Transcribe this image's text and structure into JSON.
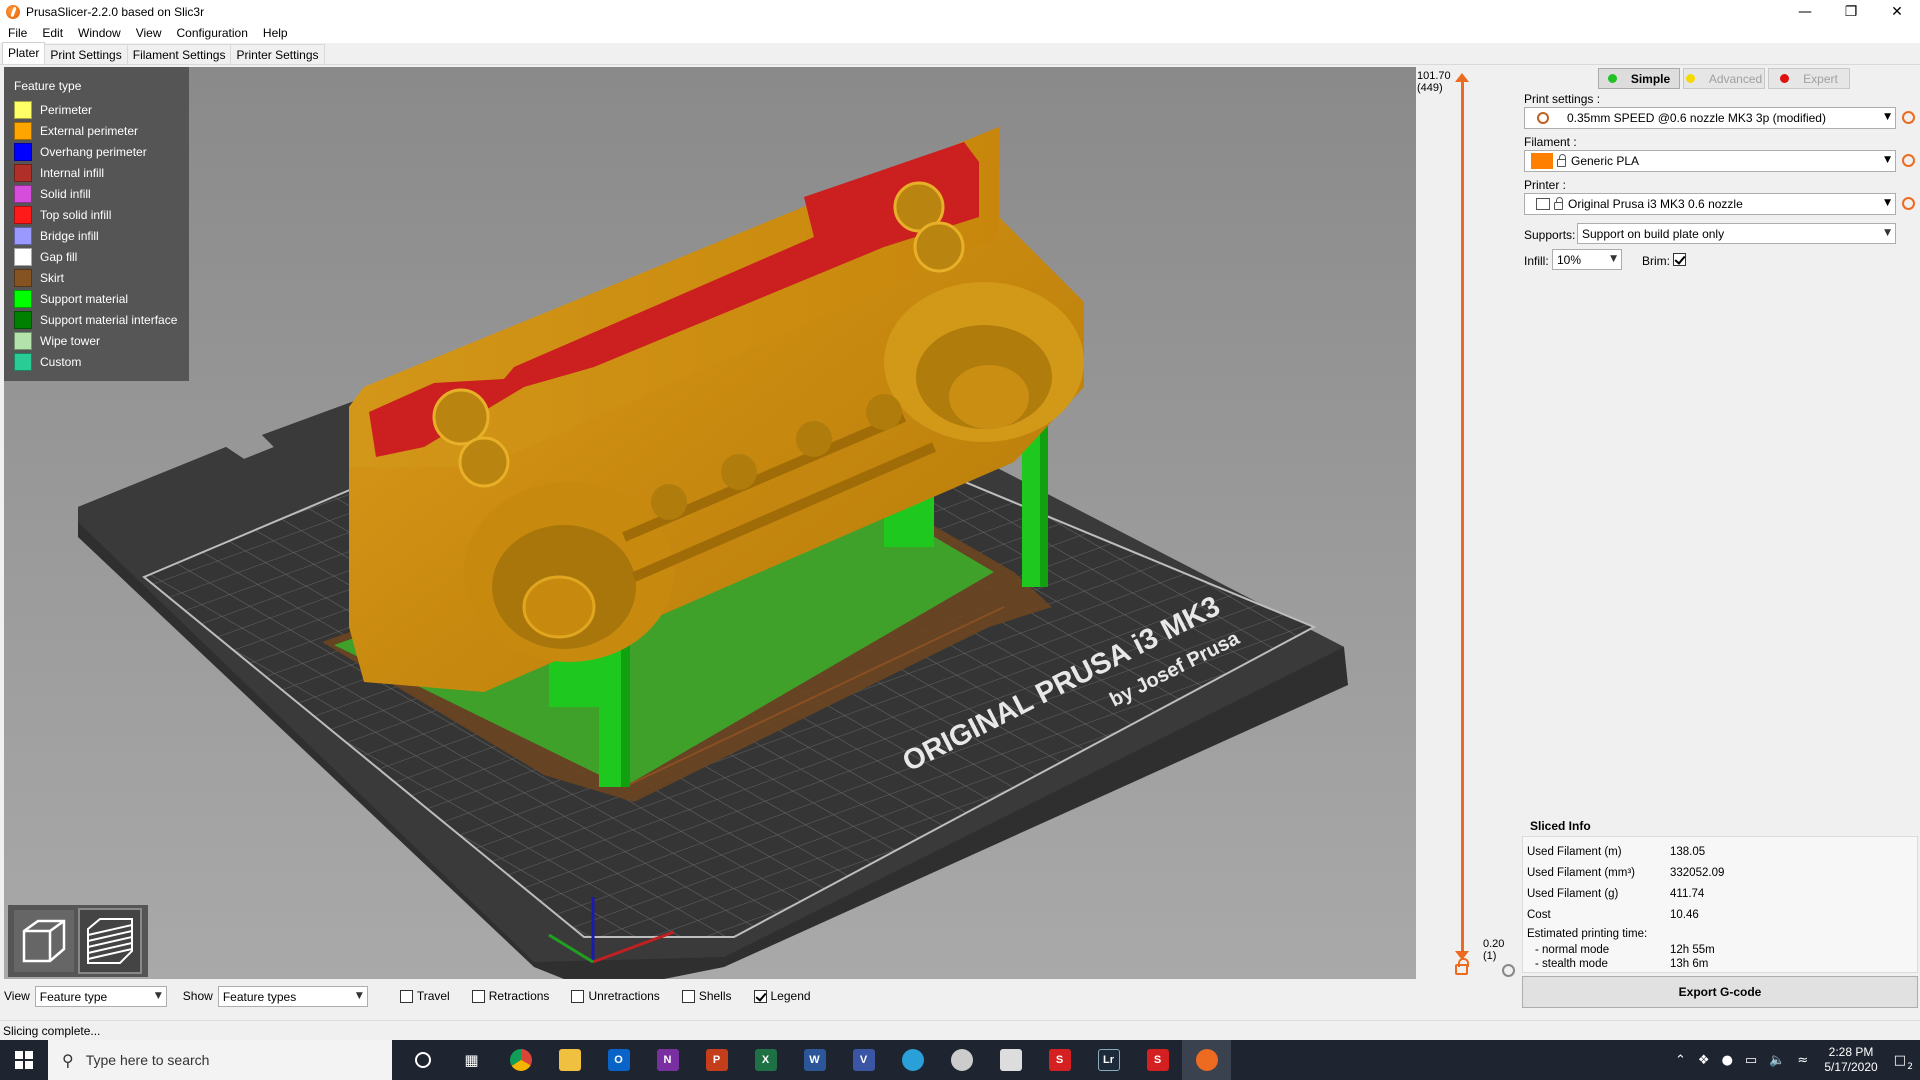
{
  "window": {
    "title": "PrusaSlicer-2.2.0 based on Slic3r"
  },
  "menu": [
    "File",
    "Edit",
    "Window",
    "View",
    "Configuration",
    "Help"
  ],
  "tabs": [
    {
      "label": "Plater",
      "active": true
    },
    {
      "label": "Print Settings",
      "active": false
    },
    {
      "label": "Filament Settings",
      "active": false
    },
    {
      "label": "Printer Settings",
      "active": false
    }
  ],
  "legend": {
    "title": "Feature type",
    "items": [
      {
        "label": "Perimeter",
        "color": "#ffff66"
      },
      {
        "label": "External perimeter",
        "color": "#ffa500"
      },
      {
        "label": "Overhang perimeter",
        "color": "#0000ff"
      },
      {
        "label": "Internal infill",
        "color": "#b03029"
      },
      {
        "label": "Solid infill",
        "color": "#d64ddb"
      },
      {
        "label": "Top solid infill",
        "color": "#ff1a1a"
      },
      {
        "label": "Bridge infill",
        "color": "#9999ff"
      },
      {
        "label": "Gap fill",
        "color": "#ffffff"
      },
      {
        "label": "Skirt",
        "color": "#845321"
      },
      {
        "label": "Support material",
        "color": "#00ff00"
      },
      {
        "label": "Support material interface",
        "color": "#008000"
      },
      {
        "label": "Wipe tower",
        "color": "#b3e3ab"
      },
      {
        "label": "Custom",
        "color": "#28cc94"
      }
    ]
  },
  "bed": {
    "brand": "ORIGINAL PRUSA i3 MK3",
    "by": "by Josef Prusa"
  },
  "layer_slider": {
    "top_value": "101.70",
    "top_layer": "(449)",
    "bottom_value": "0.20",
    "bottom_layer": "(1)"
  },
  "view_toolbar": {
    "view_label": "View",
    "view_value": "Feature type",
    "show_label": "Show",
    "show_value": "Feature types",
    "checkboxes": [
      {
        "label": "Travel",
        "checked": false
      },
      {
        "label": "Retractions",
        "checked": false
      },
      {
        "label": "Unretractions",
        "checked": false
      },
      {
        "label": "Shells",
        "checked": false
      },
      {
        "label": "Legend",
        "checked": true
      }
    ]
  },
  "status": "Slicing complete...",
  "sidebar": {
    "modes": [
      {
        "label": "Simple",
        "color": "#22c022",
        "active": true
      },
      {
        "label": "Advanced",
        "color": "#f5d900",
        "active": false
      },
      {
        "label": "Expert",
        "color": "#e01010",
        "active": false
      }
    ],
    "print_settings_label": "Print settings :",
    "print_settings_value": "0.35mm SPEED @0.6 nozzle MK3 3p (modified)",
    "filament_label": "Filament :",
    "filament_value": "Generic PLA",
    "filament_color": "#ff8000",
    "printer_label": "Printer :",
    "printer_value": "Original Prusa i3 MK3 0.6 nozzle",
    "supports_label": "Supports:",
    "supports_value": "Support on build plate only",
    "infill_label": "Infill:",
    "infill_value": "10%",
    "brim_label": "Brim:",
    "brim_checked": true,
    "sliced_info": {
      "title": "Sliced Info",
      "rows": [
        {
          "k": "Used Filament (m)",
          "v": "138.05"
        },
        {
          "k": "Used Filament (mm³)",
          "v": "332052.09"
        },
        {
          "k": "Used Filament (g)",
          "v": "411.74"
        },
        {
          "k": "Cost",
          "v": "10.46"
        }
      ],
      "time_label": "Estimated printing time:",
      "normal_label": "- normal mode",
      "normal_value": "12h 55m",
      "stealth_label": "- stealth mode",
      "stealth_value": "13h 6m"
    },
    "export_label": "Export G-code"
  },
  "taskbar": {
    "search_placeholder": "Type here to search",
    "time": "2:28 PM",
    "date": "5/17/2020",
    "notification_count": "2"
  }
}
